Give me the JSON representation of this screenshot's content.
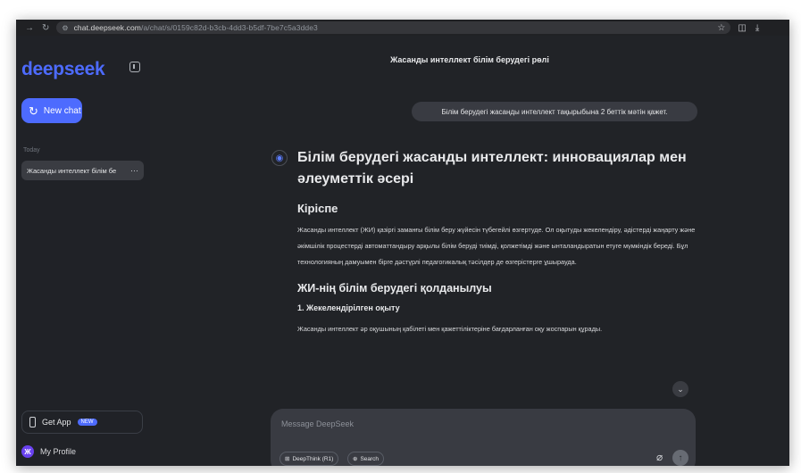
{
  "browser": {
    "url_host": "chat.deepseek.com",
    "url_path": "/a/chat/s/0159c82d-b3cb-4dd3-b5df-7be7c5a3dde3"
  },
  "sidebar": {
    "logo": "deepseek",
    "new_chat_label": "New chat",
    "section_label": "Today",
    "chat_items": [
      {
        "label": "Жасанды интеллект білім бе"
      }
    ],
    "get_app_label": "Get App",
    "new_badge": "NEW",
    "profile_initial": "Ж",
    "profile_label": "My Profile"
  },
  "main": {
    "title": "Жасанды интеллект білім берудегі рөлі",
    "user_message": "Білім берудегі жасанды интеллект тақырыбына 2 беттік мәтін қажет.",
    "response": {
      "heading": "Білім берудегі жасанды интеллект: инновациялар мен әлеуметтік әсері",
      "intro_heading": "Кіріспе",
      "intro_paragraph": "Жасанды интеллект (ЖИ) қазіргі заманғы білім беру жүйесін түбегейлі өзгертуде. Ол оқытуды жекелендіру, әдістерді жаңарту және әкімшілік процестерді автоматтандыру арқылы білім беруді тиімді, қолжетімді және ынталандыратын етуге мүмкіндік береді. Бұл технологияның дамуымен бірге дәстүрлі педагогикалық тәсілдер де өзгерістерге ұшырауда.",
      "section_heading": "ЖИ-нің білім берудегі қолданылуы",
      "subsection_heading": "1. Жекелендірілген оқыту",
      "subsection_paragraph": "Жасанды интеллект әр оқушының қабілеті мен қажеттіліктеріне бағдарланған оқу жоспарын құрады."
    },
    "composer": {
      "placeholder": "Message DeepSeek",
      "deepthink_label": "DeepThink (R1)",
      "search_label": "Search"
    }
  }
}
